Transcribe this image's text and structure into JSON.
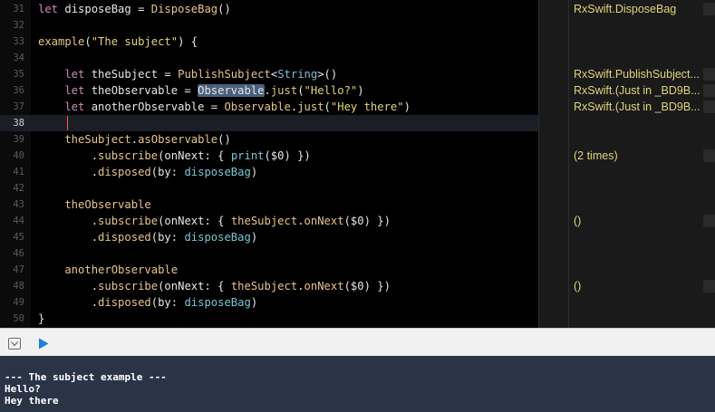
{
  "editor": {
    "lines": [
      {
        "num": "31",
        "tokens": [
          {
            "t": "let",
            "c": "kw"
          },
          {
            "t": " disposeBag = ",
            "c": ""
          },
          {
            "t": "DisposeBag",
            "c": "call"
          },
          {
            "t": "()",
            "c": ""
          }
        ]
      },
      {
        "num": "32",
        "tokens": []
      },
      {
        "num": "33",
        "tokens": [
          {
            "t": "example",
            "c": "call"
          },
          {
            "t": "(",
            "c": ""
          },
          {
            "t": "\"The subject\"",
            "c": "str"
          },
          {
            "t": ") {",
            "c": ""
          }
        ]
      },
      {
        "num": "34",
        "tokens": []
      },
      {
        "num": "35",
        "tokens": [
          {
            "t": "    let",
            "c": "kw"
          },
          {
            "t": " theSubject = ",
            "c": ""
          },
          {
            "t": "PublishSubject",
            "c": "call"
          },
          {
            "t": "<",
            "c": ""
          },
          {
            "t": "String",
            "c": "type"
          },
          {
            "t": ">()",
            "c": ""
          }
        ]
      },
      {
        "num": "36",
        "tokens": [
          {
            "t": "    let",
            "c": "kw"
          },
          {
            "t": " theObservable = ",
            "c": ""
          },
          {
            "t": "Observable",
            "c": "sel"
          },
          {
            "t": ".",
            "c": ""
          },
          {
            "t": "just",
            "c": "call"
          },
          {
            "t": "(",
            "c": ""
          },
          {
            "t": "\"Hello?\"",
            "c": "str"
          },
          {
            "t": ")",
            "c": ""
          }
        ]
      },
      {
        "num": "37",
        "tokens": [
          {
            "t": "    let",
            "c": "kw"
          },
          {
            "t": " anotherObservable = ",
            "c": ""
          },
          {
            "t": "Observable",
            "c": "call"
          },
          {
            "t": ".",
            "c": ""
          },
          {
            "t": "just",
            "c": "call"
          },
          {
            "t": "(",
            "c": ""
          },
          {
            "t": "\"Hey there\"",
            "c": "str"
          },
          {
            "t": ")",
            "c": ""
          }
        ]
      },
      {
        "num": "38",
        "tokens": [],
        "current": true
      },
      {
        "num": "39",
        "tokens": [
          {
            "t": "    theSubject",
            "c": "ident"
          },
          {
            "t": ".",
            "c": ""
          },
          {
            "t": "asObservable",
            "c": "call"
          },
          {
            "t": "()",
            "c": ""
          }
        ]
      },
      {
        "num": "40",
        "tokens": [
          {
            "t": "        .",
            "c": ""
          },
          {
            "t": "subscribe",
            "c": "call"
          },
          {
            "t": "(onNext: { ",
            "c": ""
          },
          {
            "t": "print",
            "c": "lib"
          },
          {
            "t": "($0) })",
            "c": ""
          }
        ]
      },
      {
        "num": "41",
        "tokens": [
          {
            "t": "        .",
            "c": ""
          },
          {
            "t": "disposed",
            "c": "call"
          },
          {
            "t": "(by: ",
            "c": ""
          },
          {
            "t": "disposeBag",
            "c": "lib"
          },
          {
            "t": ")",
            "c": ""
          }
        ]
      },
      {
        "num": "42",
        "tokens": []
      },
      {
        "num": "43",
        "tokens": [
          {
            "t": "    theObservable",
            "c": "ident"
          }
        ]
      },
      {
        "num": "44",
        "tokens": [
          {
            "t": "        .",
            "c": ""
          },
          {
            "t": "subscribe",
            "c": "call"
          },
          {
            "t": "(onNext: { ",
            "c": ""
          },
          {
            "t": "theSubject",
            "c": "ident"
          },
          {
            "t": ".",
            "c": ""
          },
          {
            "t": "onNext",
            "c": "call"
          },
          {
            "t": "($0) })",
            "c": ""
          }
        ]
      },
      {
        "num": "45",
        "tokens": [
          {
            "t": "        .",
            "c": ""
          },
          {
            "t": "disposed",
            "c": "call"
          },
          {
            "t": "(by: ",
            "c": ""
          },
          {
            "t": "disposeBag",
            "c": "lib"
          },
          {
            "t": ")",
            "c": ""
          }
        ]
      },
      {
        "num": "46",
        "tokens": []
      },
      {
        "num": "47",
        "tokens": [
          {
            "t": "    anotherObservable",
            "c": "ident"
          }
        ]
      },
      {
        "num": "48",
        "tokens": [
          {
            "t": "        .",
            "c": ""
          },
          {
            "t": "subscribe",
            "c": "call"
          },
          {
            "t": "(onNext: { ",
            "c": ""
          },
          {
            "t": "theSubject",
            "c": "ident"
          },
          {
            "t": ".",
            "c": ""
          },
          {
            "t": "onNext",
            "c": "call"
          },
          {
            "t": "($0) })",
            "c": ""
          }
        ]
      },
      {
        "num": "49",
        "tokens": [
          {
            "t": "        .",
            "c": ""
          },
          {
            "t": "disposed",
            "c": "call"
          },
          {
            "t": "(by: ",
            "c": ""
          },
          {
            "t": "disposeBag",
            "c": "lib"
          },
          {
            "t": ")",
            "c": ""
          }
        ]
      },
      {
        "num": "50",
        "tokens": [
          {
            "t": "}",
            "c": ""
          }
        ]
      }
    ]
  },
  "results": [
    {
      "line_index": 0,
      "text": "RxSwift.DisposeBag"
    },
    {
      "line_index": 4,
      "text": "RxSwift.PublishSubject..."
    },
    {
      "line_index": 5,
      "text": "RxSwift.(Just in _BD9B..."
    },
    {
      "line_index": 6,
      "text": "RxSwift.(Just in _BD9B..."
    },
    {
      "line_index": 9,
      "text": "(2 times)"
    },
    {
      "line_index": 13,
      "text": "()"
    },
    {
      "line_index": 17,
      "text": "()"
    }
  ],
  "toolbar": {
    "hide_console_icon": "hide-debug-area-icon",
    "run_icon": "play-icon"
  },
  "console": {
    "lines": [
      "--- The subject example ---",
      "Hello?",
      "Hey there"
    ]
  },
  "colors": {
    "editor_bg": "#000000",
    "keyword": "#d08bb8",
    "string": "#e0d479",
    "result_text": "#e0d479",
    "console_bg": "#2a3447",
    "selection": "#4a5f7e",
    "cursor": "#ff5a4a"
  }
}
